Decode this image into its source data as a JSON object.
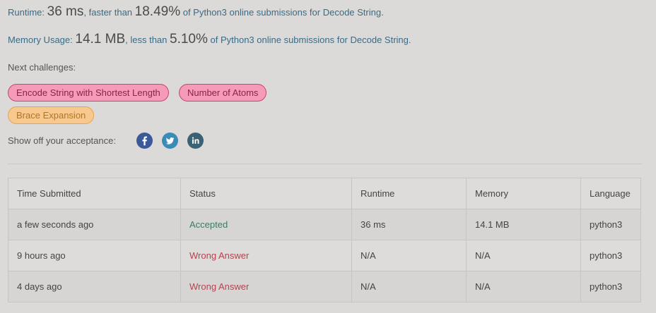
{
  "result": {
    "runtime_prefix": "Runtime: ",
    "runtime_value": "36 ms",
    "runtime_mid": ", faster than ",
    "runtime_percent": "18.49%",
    "runtime_suffix": " of Python3 online submissions for Decode String.",
    "memory_prefix": "Memory Usage: ",
    "memory_value": "14.1 MB",
    "memory_mid": ", less than ",
    "memory_percent": "5.10%",
    "memory_suffix": " of Python3 online submissions for Decode String."
  },
  "next_challenges": {
    "label": "Next challenges:",
    "items": [
      {
        "label": "Encode String with Shortest Length",
        "difficulty": "hard"
      },
      {
        "label": "Number of Atoms",
        "difficulty": "hard"
      },
      {
        "label": "Brace Expansion",
        "difficulty": "medium"
      }
    ]
  },
  "share": {
    "label": "Show off your acceptance:",
    "icons": [
      "facebook-icon",
      "twitter-icon",
      "linkedin-icon"
    ]
  },
  "colors": {
    "facebook": "#3b5998",
    "twitter": "#3a8bb5",
    "linkedin": "#3b6274",
    "accepted": "#3d7a6a",
    "wrong": "#b5434d"
  },
  "table": {
    "headers": [
      "Time Submitted",
      "Status",
      "Runtime",
      "Memory",
      "Language"
    ],
    "rows": [
      [
        "a few seconds ago",
        "Accepted",
        "36 ms",
        "14.1 MB",
        "python3"
      ],
      [
        "9 hours ago",
        "Wrong Answer",
        "N/A",
        "N/A",
        "python3"
      ],
      [
        "4 days ago",
        "Wrong Answer",
        "N/A",
        "N/A",
        "python3"
      ]
    ]
  }
}
